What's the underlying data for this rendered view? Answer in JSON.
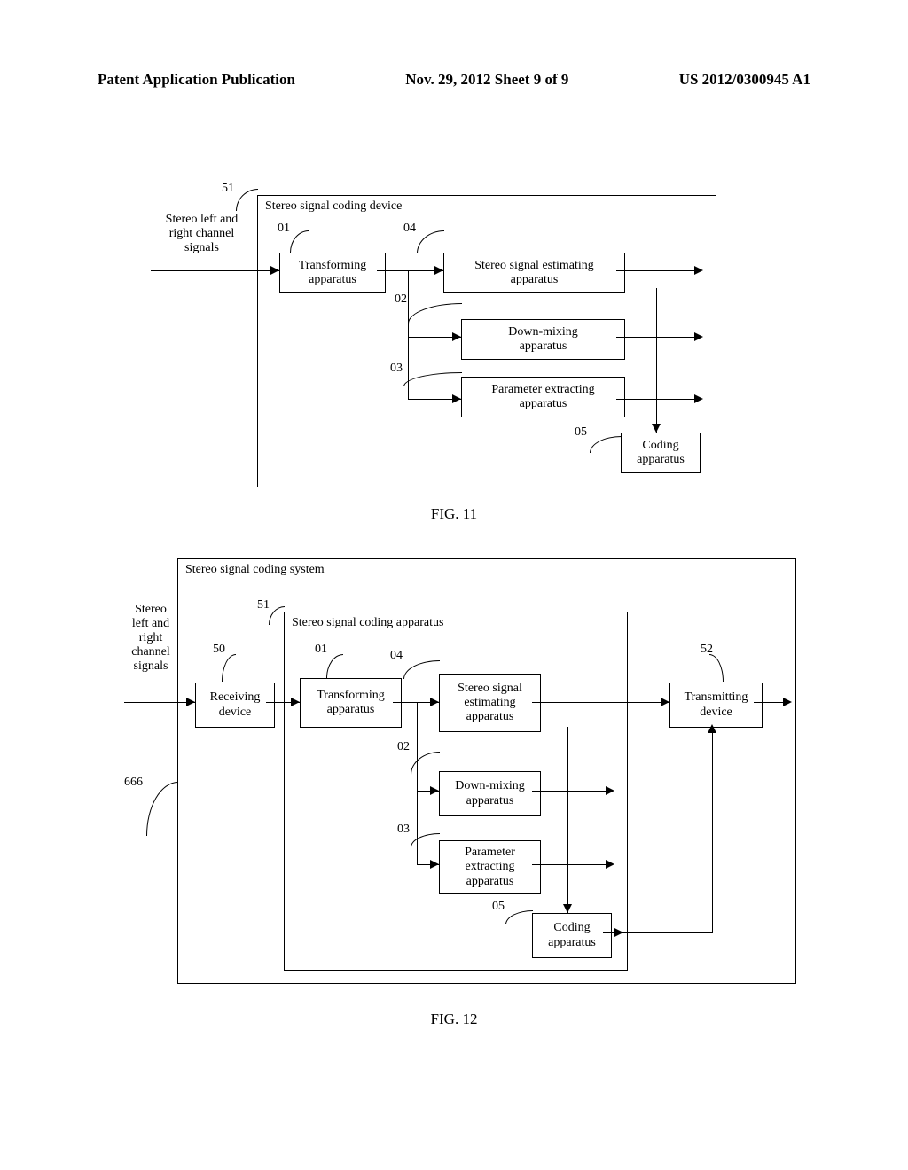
{
  "header": {
    "left": "Patent Application Publication",
    "center": "Nov. 29, 2012  Sheet 9 of 9",
    "right": "US 2012/0300945 A1"
  },
  "fig11": {
    "caption": "FIG. 11",
    "input_label": "Stereo left and\nright channel\nsignals",
    "device_title": "Stereo signal coding device",
    "device_num": "51",
    "blocks": {
      "transforming": {
        "num": "01",
        "text": "Transforming\napparatus"
      },
      "estimating": {
        "num": "04",
        "text": "Stereo signal estimating\napparatus"
      },
      "downmixing": {
        "num": "02",
        "text": "Down-mixing\napparatus"
      },
      "parameter": {
        "num": "03",
        "text": "Parameter extracting\napparatus"
      },
      "coding": {
        "num": "05",
        "text": "Coding\napparatus"
      }
    }
  },
  "fig12": {
    "caption": "FIG. 12",
    "input_label": "Stereo\nleft and\nright\nchannel\nsignals",
    "system_title": "Stereo signal coding system",
    "system_num": "666",
    "apparatus_title": "Stereo signal coding apparatus",
    "apparatus_num": "51",
    "receiving": {
      "num": "50",
      "text": "Receiving\ndevice"
    },
    "transmitting": {
      "num": "52",
      "text": "Transmitting\ndevice"
    },
    "blocks": {
      "transforming": {
        "num": "01",
        "text": "Transforming\napparatus"
      },
      "estimating": {
        "num": "04",
        "text": "Stereo signal\nestimating\napparatus"
      },
      "downmixing": {
        "num": "02",
        "text": "Down-mixing\napparatus"
      },
      "parameter": {
        "num": "03",
        "text": "Parameter\nextracting\napparatus"
      },
      "coding": {
        "num": "05",
        "text": "Coding\napparatus"
      }
    }
  }
}
